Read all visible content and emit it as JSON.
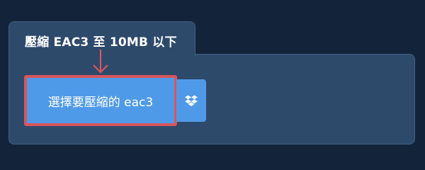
{
  "tab": {
    "title": "壓縮 EAC3 至 10MB 以下"
  },
  "upload": {
    "button_label": "選擇要壓縮的 eac3",
    "dropbox_icon": "dropbox-icon"
  },
  "colors": {
    "background": "#13243a",
    "panel": "#2e4a6b",
    "button": "#4f9ae8",
    "highlight": "#d9555b"
  }
}
